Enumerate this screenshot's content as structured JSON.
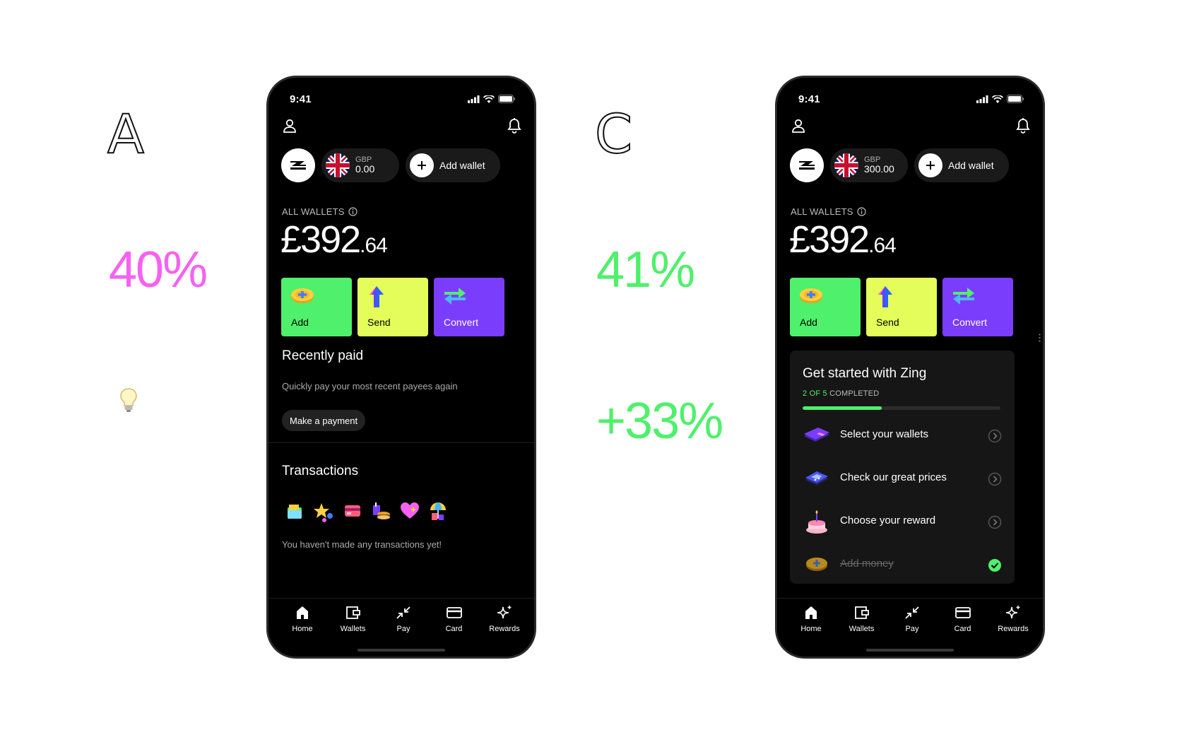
{
  "variant_a": {
    "letter": "A",
    "stat": "40%",
    "stat_color": "#f562f0"
  },
  "variant_c": {
    "letter": "C",
    "stat": "41%",
    "stat_change": "+33%",
    "stat_color": "#4ff06b"
  },
  "phone_a": {
    "status_time": "9:41",
    "wallet": {
      "currency": "GBP",
      "amount": "0.00"
    },
    "add_wallet_label": "Add wallet",
    "all_wallets_label": "ALL WALLETS",
    "balance_main": "£392",
    "balance_decimal": ".64",
    "actions": [
      {
        "label": "Add",
        "color": "#4ff06b"
      },
      {
        "label": "Send",
        "color": "#e4fd5a"
      },
      {
        "label": "Convert",
        "color": "#7b3dfc"
      }
    ],
    "recently_paid": {
      "title": "Recently paid",
      "subtitle": "Quickly pay your most recent payees again",
      "button": "Make a payment"
    },
    "transactions": {
      "title": "Transactions",
      "empty_text": "You haven't made any transactions yet!",
      "icons": [
        "wallet-sticker-icon",
        "stars-sticker-icon",
        "card-sticker-icon",
        "food-sticker-icon",
        "heart-sticker-icon",
        "umbrella-sticker-icon"
      ]
    },
    "nav": [
      "Home",
      "Wallets",
      "Pay",
      "Card",
      "Rewards"
    ]
  },
  "phone_c": {
    "status_time": "9:41",
    "wallet": {
      "currency": "GBP",
      "amount": "300.00"
    },
    "add_wallet_label": "Add wallet",
    "all_wallets_label": "ALL WALLETS",
    "balance_main": "£392",
    "balance_decimal": ".64",
    "actions": [
      {
        "label": "Add",
        "color": "#4ff06b"
      },
      {
        "label": "Send",
        "color": "#e4fd5a"
      },
      {
        "label": "Convert",
        "color": "#7b3dfc"
      }
    ],
    "get_started": {
      "title": "Get started with Zing",
      "progress_count": "2 OF 5",
      "progress_suffix": "COMPLETED",
      "progress_fraction": 0.4,
      "items": [
        {
          "label": "Select your wallets",
          "done": false
        },
        {
          "label": "Check our great prices",
          "done": false
        },
        {
          "label": "Choose your reward",
          "done": false
        },
        {
          "label": "Add money",
          "done": true
        }
      ]
    },
    "nav": [
      "Home",
      "Wallets",
      "Pay",
      "Card",
      "Rewards"
    ]
  },
  "colors": {
    "background": "#ffffff",
    "phone_bg": "#000000",
    "green": "#4ff06b",
    "yellow": "#e4fd5a",
    "purple": "#7b3dfc",
    "pink": "#f562f0"
  }
}
